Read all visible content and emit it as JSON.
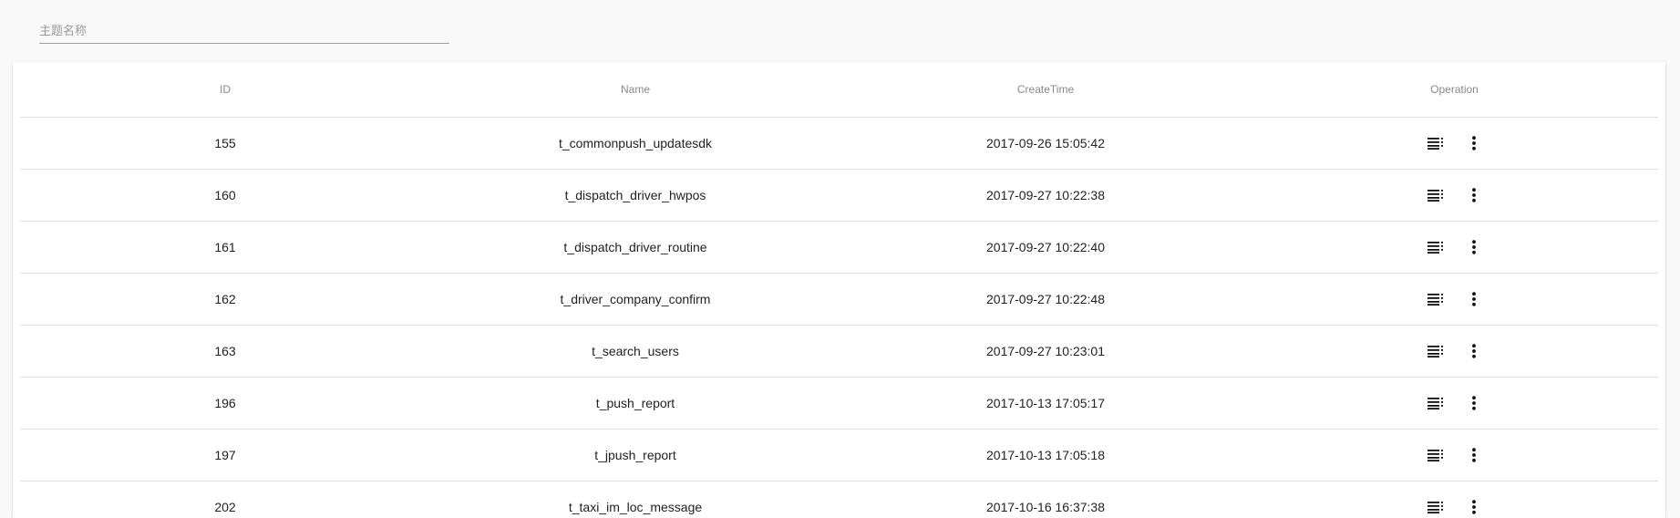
{
  "filter": {
    "search_placeholder": "主题名称",
    "search_value": ""
  },
  "table": {
    "headers": {
      "id": "ID",
      "name": "Name",
      "create_time": "CreateTime",
      "operation": "Operation"
    },
    "rows": [
      {
        "id": "155",
        "name": "t_commonpush_updatesdk",
        "create_time": "2017-09-26 15:05:42"
      },
      {
        "id": "160",
        "name": "t_dispatch_driver_hwpos",
        "create_time": "2017-09-27 10:22:38"
      },
      {
        "id": "161",
        "name": "t_dispatch_driver_routine",
        "create_time": "2017-09-27 10:22:40"
      },
      {
        "id": "162",
        "name": "t_driver_company_confirm",
        "create_time": "2017-09-27 10:22:48"
      },
      {
        "id": "163",
        "name": "t_search_users",
        "create_time": "2017-09-27 10:23:01"
      },
      {
        "id": "196",
        "name": "t_push_report",
        "create_time": "2017-10-13 17:05:17"
      },
      {
        "id": "197",
        "name": "t_jpush_report",
        "create_time": "2017-10-13 17:05:18"
      },
      {
        "id": "202",
        "name": "t_taxi_im_loc_message",
        "create_time": "2017-10-16 16:37:38"
      }
    ],
    "row_icons": [
      "list-detail-icon",
      "more-vert-icon"
    ]
  },
  "colors": {
    "page_background": "#f9f9f9",
    "card_background": "#ffffff",
    "divider": "#e0e0e0",
    "header_text": "#8a8a8a",
    "cell_text": "#222222"
  }
}
